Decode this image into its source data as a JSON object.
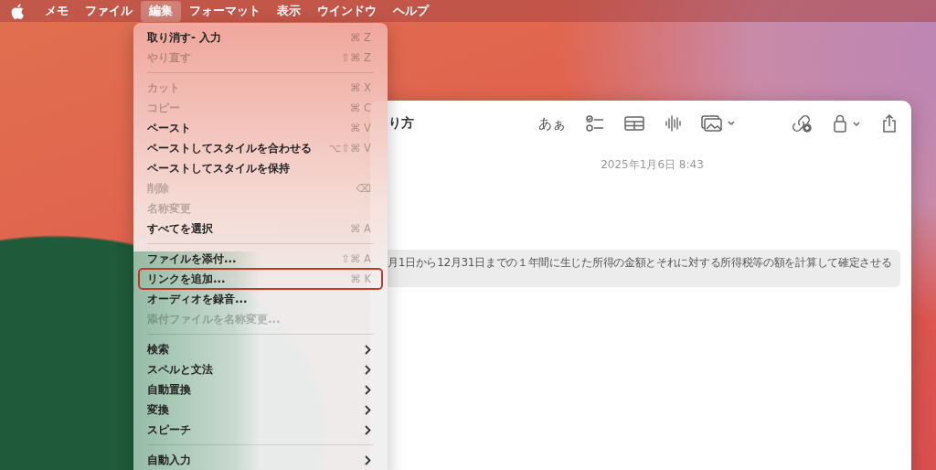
{
  "menu_bar": {
    "items": [
      {
        "label": "メモ",
        "selected": false
      },
      {
        "label": "ファイル",
        "selected": false
      },
      {
        "label": "編集",
        "selected": true
      },
      {
        "label": "フォーマット",
        "selected": false
      },
      {
        "label": "表示",
        "selected": false
      },
      {
        "label": "ウインドウ",
        "selected": false
      },
      {
        "label": "ヘルプ",
        "selected": false
      }
    ]
  },
  "edit_menu": {
    "items": [
      {
        "kind": "item",
        "label": "取り消す- 入力",
        "shortcut": "⌘ Z",
        "disabled": false,
        "outlined": false,
        "submenu": false
      },
      {
        "kind": "item",
        "label": "やり直す",
        "shortcut": "⇧⌘ Z",
        "disabled": true,
        "outlined": false,
        "submenu": false
      },
      {
        "kind": "separator"
      },
      {
        "kind": "item",
        "label": "カット",
        "shortcut": "⌘ X",
        "disabled": true,
        "outlined": false,
        "submenu": false
      },
      {
        "kind": "item",
        "label": "コピー",
        "shortcut": "⌘ C",
        "disabled": true,
        "outlined": false,
        "submenu": false
      },
      {
        "kind": "item",
        "label": "ペースト",
        "shortcut": "⌘ V",
        "disabled": false,
        "outlined": false,
        "submenu": false
      },
      {
        "kind": "item",
        "label": "ペーストしてスタイルを合わせる",
        "shortcut": "⌥⇧⌘ V",
        "disabled": false,
        "outlined": false,
        "submenu": false
      },
      {
        "kind": "item",
        "label": "ペーストしてスタイルを保持",
        "disabled": false,
        "outlined": false,
        "submenu": false
      },
      {
        "kind": "item",
        "label": "削除",
        "shortcut": "⌫",
        "disabled": true,
        "outlined": false,
        "submenu": false
      },
      {
        "kind": "item",
        "label": "名称変更",
        "disabled": true,
        "outlined": false,
        "submenu": false
      },
      {
        "kind": "item",
        "label": "すべてを選択",
        "shortcut": "⌘ A",
        "disabled": false,
        "outlined": false,
        "submenu": false
      },
      {
        "kind": "separator"
      },
      {
        "kind": "item",
        "label": "ファイルを添付...",
        "shortcut": "⇧⌘ A",
        "disabled": false,
        "outlined": false,
        "submenu": false
      },
      {
        "kind": "item",
        "label": "リンクを追加...",
        "shortcut": "⌘ K",
        "disabled": false,
        "outlined": true,
        "submenu": false
      },
      {
        "kind": "item",
        "label": "オーディオを録音...",
        "disabled": false,
        "outlined": false,
        "submenu": false
      },
      {
        "kind": "item",
        "label": "添付ファイルを名称変更...",
        "disabled": true,
        "outlined": false,
        "submenu": false
      },
      {
        "kind": "separator"
      },
      {
        "kind": "item",
        "label": "検索",
        "disabled": false,
        "outlined": false,
        "submenu": true
      },
      {
        "kind": "item",
        "label": "スペルと文法",
        "disabled": false,
        "outlined": false,
        "submenu": true
      },
      {
        "kind": "item",
        "label": "自動置換",
        "disabled": false,
        "outlined": false,
        "submenu": true
      },
      {
        "kind": "item",
        "label": "変換",
        "disabled": false,
        "outlined": false,
        "submenu": true
      },
      {
        "kind": "item",
        "label": "スピーチ",
        "disabled": false,
        "outlined": false,
        "submenu": true
      },
      {
        "kind": "separator"
      },
      {
        "kind": "item",
        "label": "自動入力",
        "disabled": false,
        "outlined": false,
        "submenu": true
      }
    ]
  },
  "note_window": {
    "title": "り方",
    "format_button": "あぁ",
    "date": "2025年1月6日 8:43",
    "body_text": "月1日から12月31日までの１年間に生じた所得の金額とそれに対する所得税等の額を計算して確定させる"
  }
}
